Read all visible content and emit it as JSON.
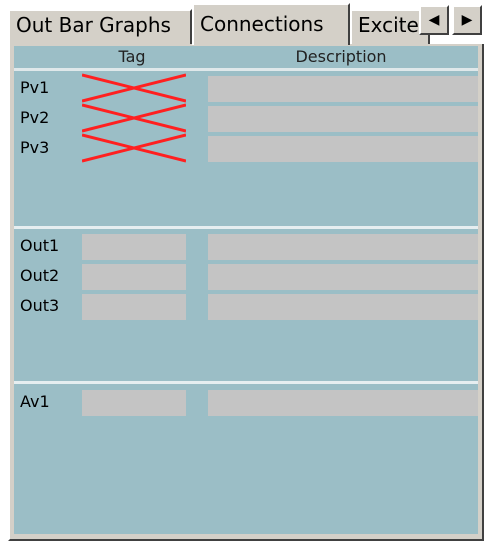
{
  "tabs": [
    {
      "label": "Out Bar Graphs"
    },
    {
      "label": "Connections"
    },
    {
      "label": "Excite"
    }
  ],
  "scroll": {
    "left": "◀",
    "right": "▶"
  },
  "columns": {
    "tag": "Tag",
    "description": "Description"
  },
  "groups": {
    "pv": [
      {
        "label": "Pv1"
      },
      {
        "label": "Pv2"
      },
      {
        "label": "Pv3"
      }
    ],
    "out": [
      {
        "label": "Out1"
      },
      {
        "label": "Out2"
      },
      {
        "label": "Out3"
      }
    ],
    "av": [
      {
        "label": "Av1"
      }
    ]
  },
  "colors": {
    "background": "#9bbec6",
    "field": "#c4c4c4",
    "error_mark": "#ff2020"
  }
}
